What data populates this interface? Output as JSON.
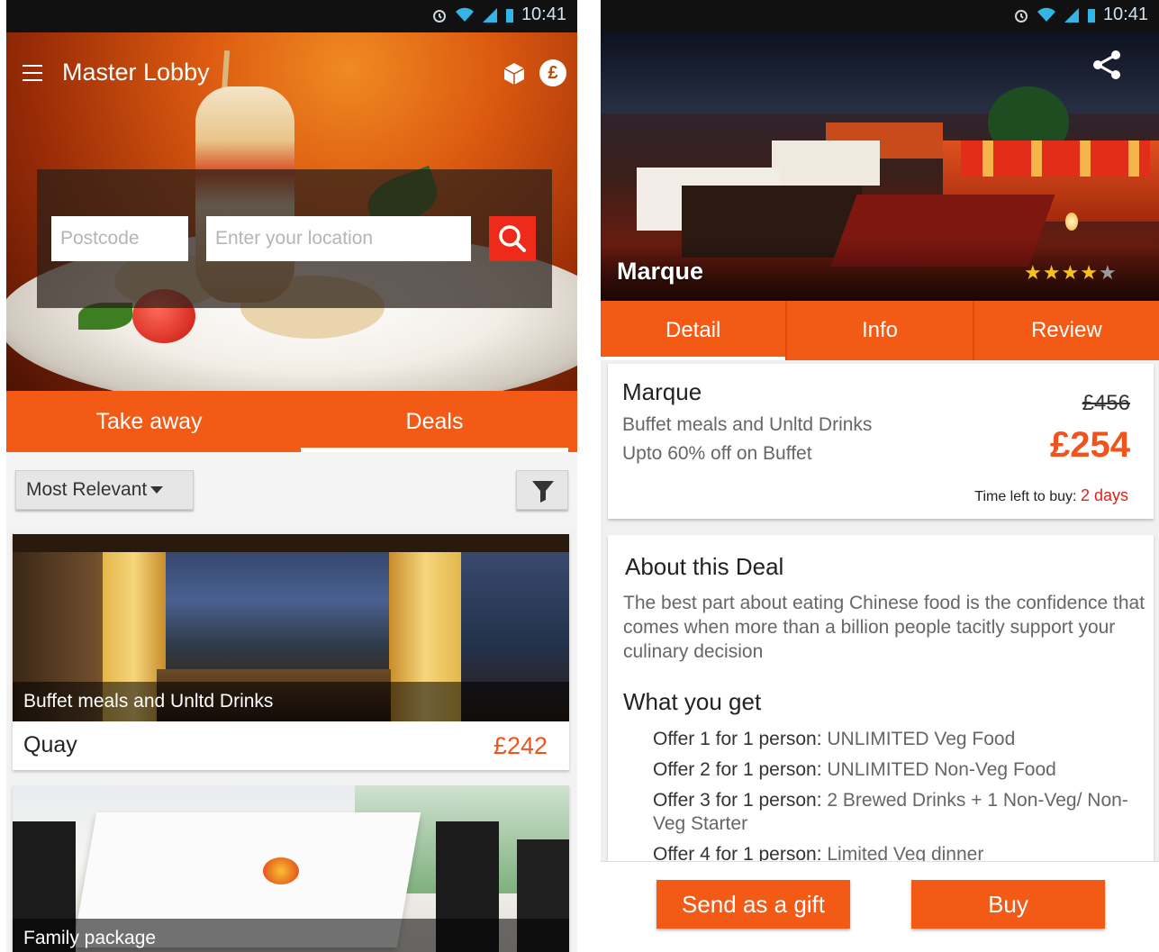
{
  "left_screen": {
    "status_bar": {
      "time": "10:41"
    },
    "app_bar": {
      "title": "Master Lobby",
      "cube_icon": "cube-icon",
      "currency_icon": "£"
    },
    "search": {
      "postcode_placeholder": "Postcode",
      "location_placeholder": "Enter your location"
    },
    "tabs": [
      {
        "label": "Take away",
        "active": false
      },
      {
        "label": "Deals",
        "active": true
      }
    ],
    "sort": {
      "selected": "Most Relevant"
    },
    "deals": [
      {
        "caption": "Buffet meals and Unltd Drinks",
        "name": "Quay",
        "price": "£242"
      },
      {
        "caption": "Family package"
      }
    ]
  },
  "right_screen": {
    "status_bar": {
      "time": "10:41"
    },
    "venue": {
      "name": "Marque",
      "rating": 4,
      "rating_max": 5
    },
    "tabs": [
      {
        "label": "Detail",
        "active": true
      },
      {
        "label": "Info",
        "active": false
      },
      {
        "label": "Review",
        "active": false
      }
    ],
    "deal": {
      "name": "Marque",
      "line1": "Buffet meals and Unltd Drinks",
      "line2": "Upto 60% off on Buffet",
      "old_price": "£456",
      "new_price": "£254",
      "time_left_label": "Time left to buy:",
      "time_left_value": "2 days"
    },
    "about": {
      "title": "About this Deal",
      "text": "The best part about eating Chinese food is the confidence that comes when more than a billion people tacitly support your culinary decision",
      "what_you_get_title": "What you get",
      "offers": [
        {
          "label": "Offer 1 for 1 person:",
          "value": " UNLIMITED Veg Food"
        },
        {
          "label": "Offer 2 for 1 person:",
          "value": " UNLIMITED Non-Veg Food"
        },
        {
          "label": "Offer 3 for 1 person:",
          "value": " 2 Brewed Drinks + 1 Non-Veg/ Non-Veg Starter"
        },
        {
          "label": "Offer 4 for 1 person:",
          "value": " Limited Veg dinner"
        }
      ]
    },
    "actions": {
      "gift_label": "Send as a gift",
      "buy_label": "Buy"
    }
  },
  "colors": {
    "accent": "#f25a16",
    "price": "#f0531c",
    "time_left": "#e0211b",
    "star": "#f6c21e"
  }
}
